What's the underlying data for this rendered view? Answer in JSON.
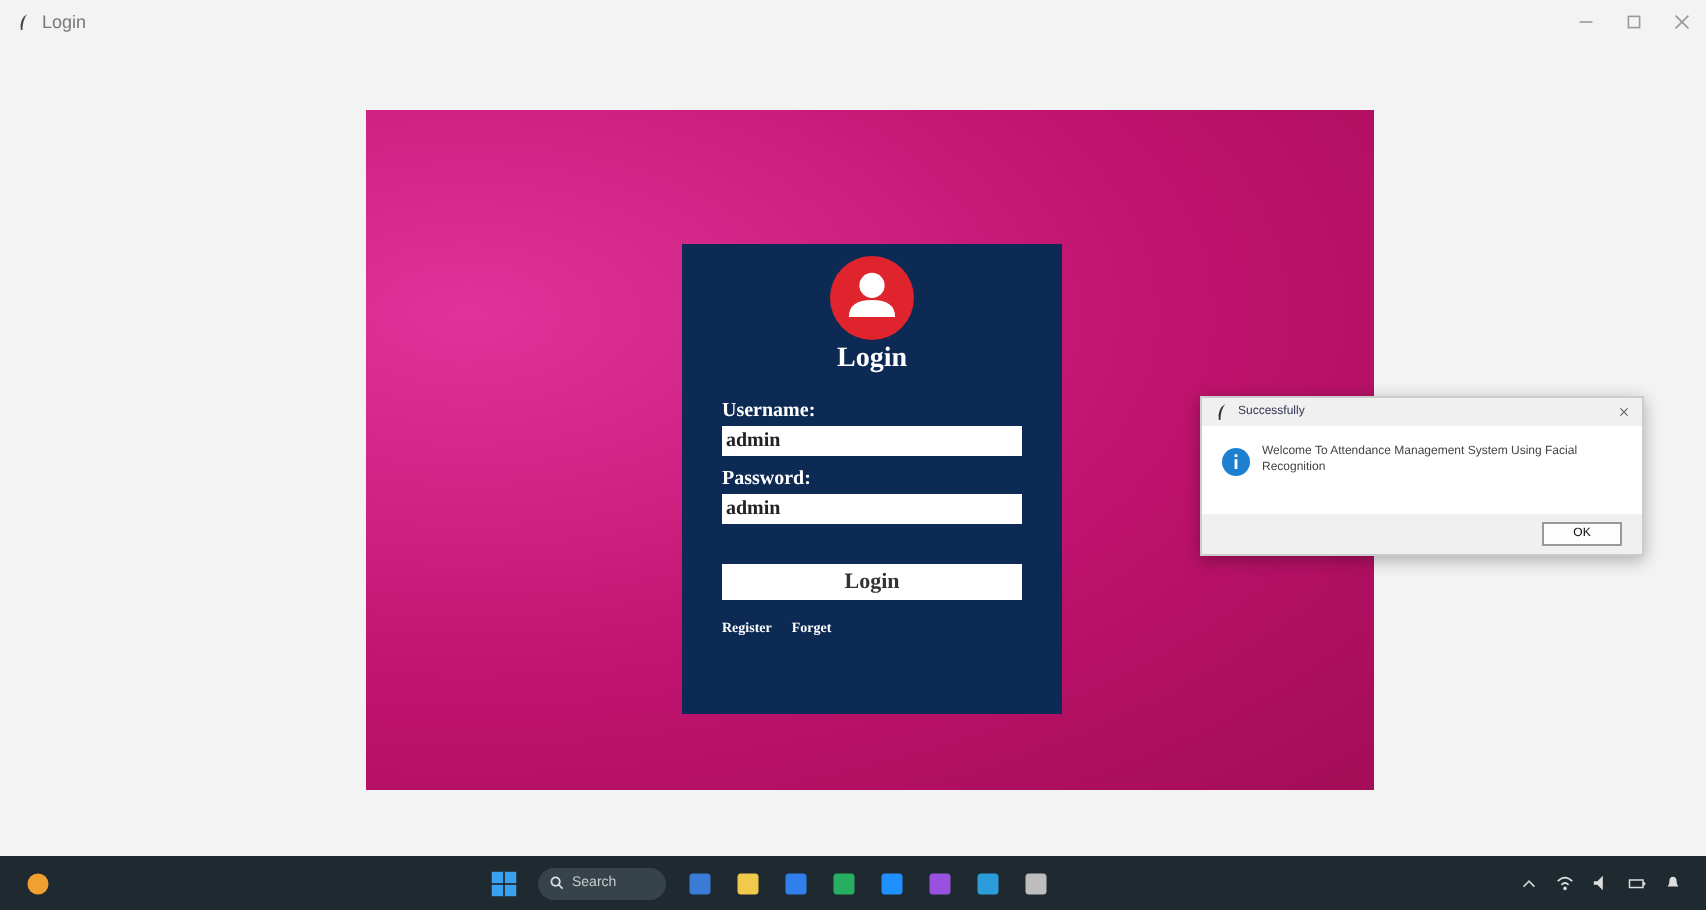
{
  "window": {
    "title": "Login"
  },
  "login_form": {
    "heading": "Login",
    "fields": [
      {
        "label": "Username:",
        "value": "admin"
      },
      {
        "label": "Password:",
        "value": "admin"
      }
    ],
    "button": "Login",
    "links": [
      "Register",
      "Forget"
    ]
  },
  "dialog": {
    "title": "Successfully",
    "message": "Welcome To Attendance Management System Using Facial Recognition",
    "button": "OK"
  },
  "taskbar": {
    "search": {
      "placeholder": "Search"
    }
  }
}
